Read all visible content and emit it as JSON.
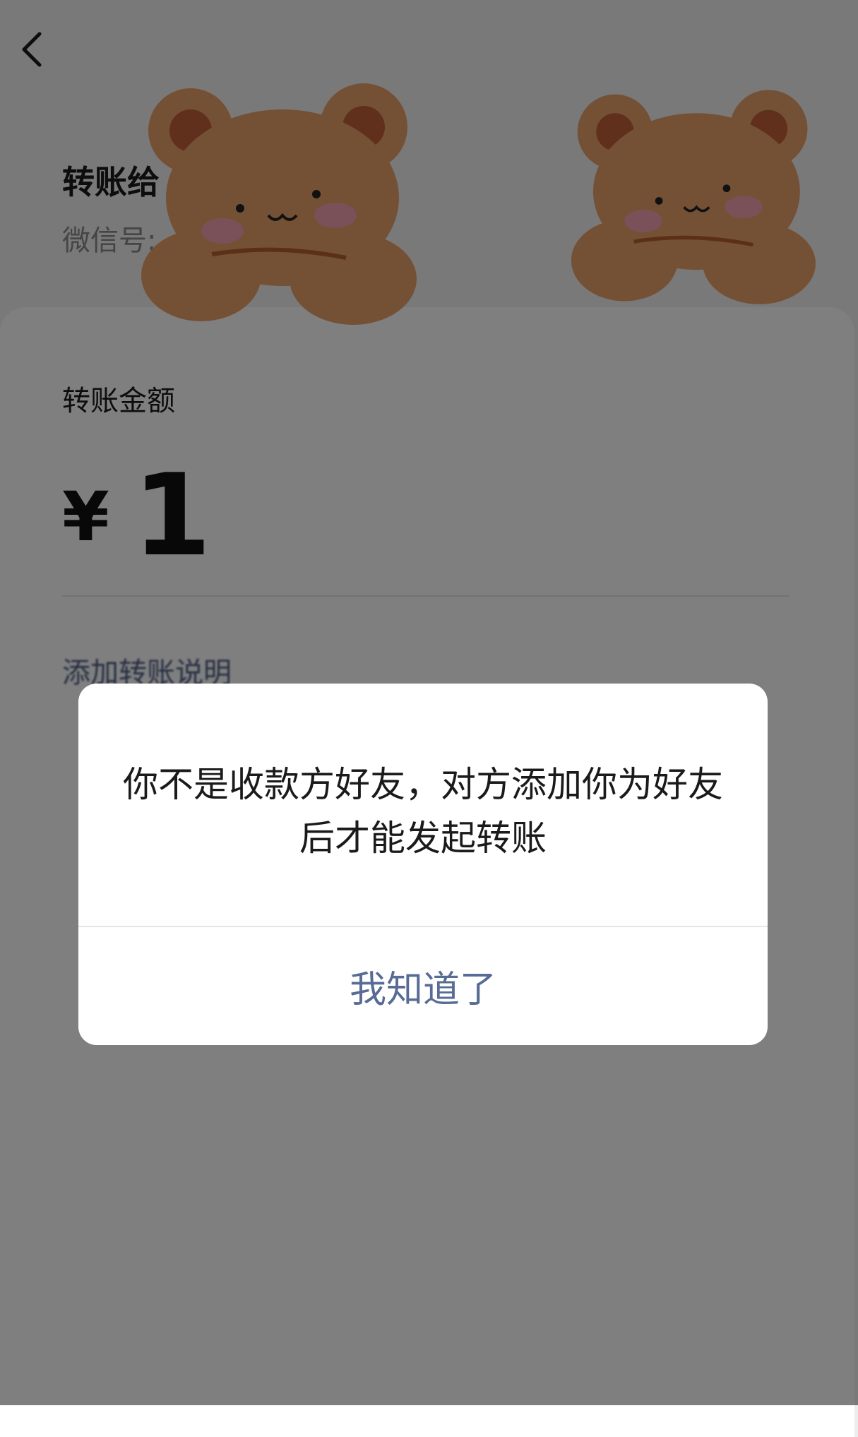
{
  "header": {
    "back_icon": "chevron-left-icon",
    "recipient_name": "转账给",
    "recipient_id_label": "微信号:"
  },
  "transfer": {
    "amount_label": "转账金额",
    "currency_symbol": "¥",
    "amount": "1",
    "note_link": "添加转账说明"
  },
  "stickers": [
    "teddy-bear-sticker",
    "teddy-bear-sticker"
  ],
  "dialog": {
    "message": "你不是收款方好友，对方添加你为好友后才能发起转账",
    "confirm_label": "我知道了"
  },
  "colors": {
    "link_blue": "#576b95",
    "overlay": "rgba(0,0,0,0.5)",
    "bear_fur": "#e9a06a"
  }
}
